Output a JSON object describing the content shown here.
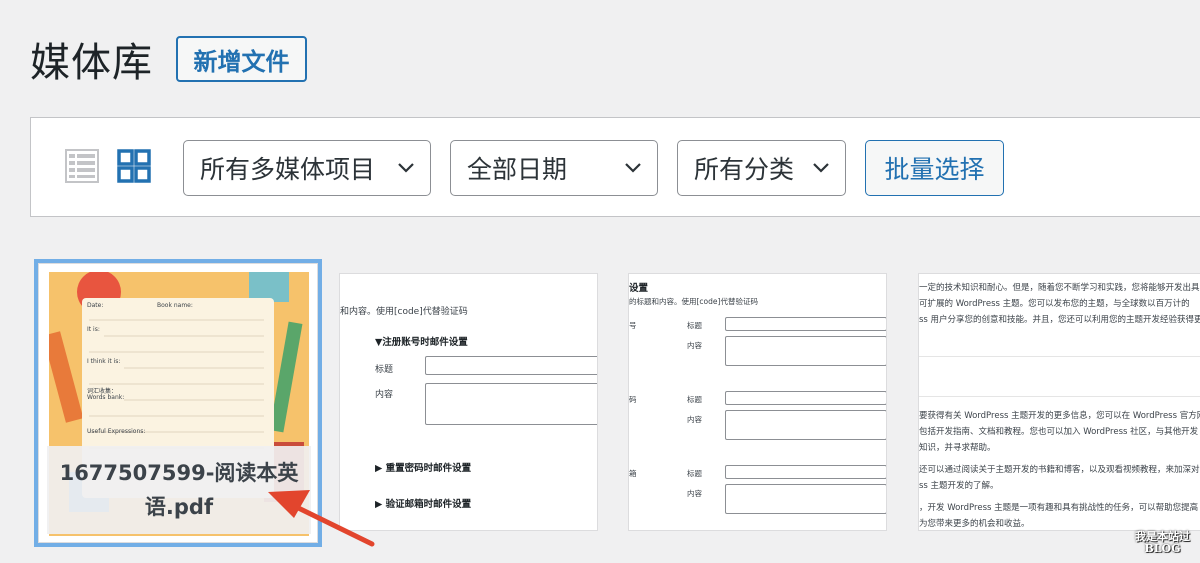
{
  "header": {
    "title": "媒体库",
    "add_new_label": "新增文件"
  },
  "toolbar": {
    "view_list_icon": "list-view-icon",
    "view_grid_icon": "grid-view-icon",
    "filter_type": "所有多媒体项目",
    "filter_date": "全部日期",
    "filter_category": "所有分类",
    "bulk_select_label": "批量选择"
  },
  "items": [
    {
      "caption": "1677507599-阅读本英语.pdf",
      "thumb_texts": {
        "date": "Date:",
        "book": "Book name:",
        "it_is": "It is:",
        "think": "I think it is:",
        "words": "Words bank:",
        "words_cn": "词汇收集：",
        "useful": "Useful Expressions:"
      }
    },
    {
      "top_text": "和内容。使用[code]代替验证码",
      "section1": "▼注册账号时邮件设置",
      "label_title": "标题",
      "label_content": "内容",
      "section2": "▶ 重置密码时邮件设置",
      "section3": "▶ 验证邮箱时邮件设置"
    },
    {
      "heading": "设置",
      "top_text": "的标题和内容。使用[code]代替验证码",
      "label_title": "标题",
      "label_content": "内容",
      "left_labels": [
        "号",
        "码",
        "箱"
      ]
    },
    {
      "lines": [
        "一定的技术知识和耐心。但是，随着您不断学习和实践，您将能够开发出具",
        "可扩展的 WordPress 主题。您可以发布您的主题，与全球数以百万计的",
        "ss 用户分享您的创意和技能。并且，您还可以利用您的主题开发经验获得更",
        "要获得有关 WordPress 主题开发的更多信息，您可以在 WordPress 官方网",
        "包括开发指南、文档和教程。您也可以加入 WordPress 社区，与其他开发",
        "知识，并寻求帮助。",
        "还可以通过阅读关于主题开发的书籍和博客，以及观看视频教程，来加深对",
        "ss 主题开发的了解。",
        "，开发 WordPress 主题是一项有趣和具有挑战性的任务，可以帮助您提高",
        "为您带来更多的机会和收益。"
      ]
    }
  ],
  "watermark": {
    "line1": "我是本站过",
    "line2": "BLOG"
  },
  "colors": {
    "accent": "#2271b1",
    "selected": "#72aee6",
    "arrow": "#e2452d"
  }
}
